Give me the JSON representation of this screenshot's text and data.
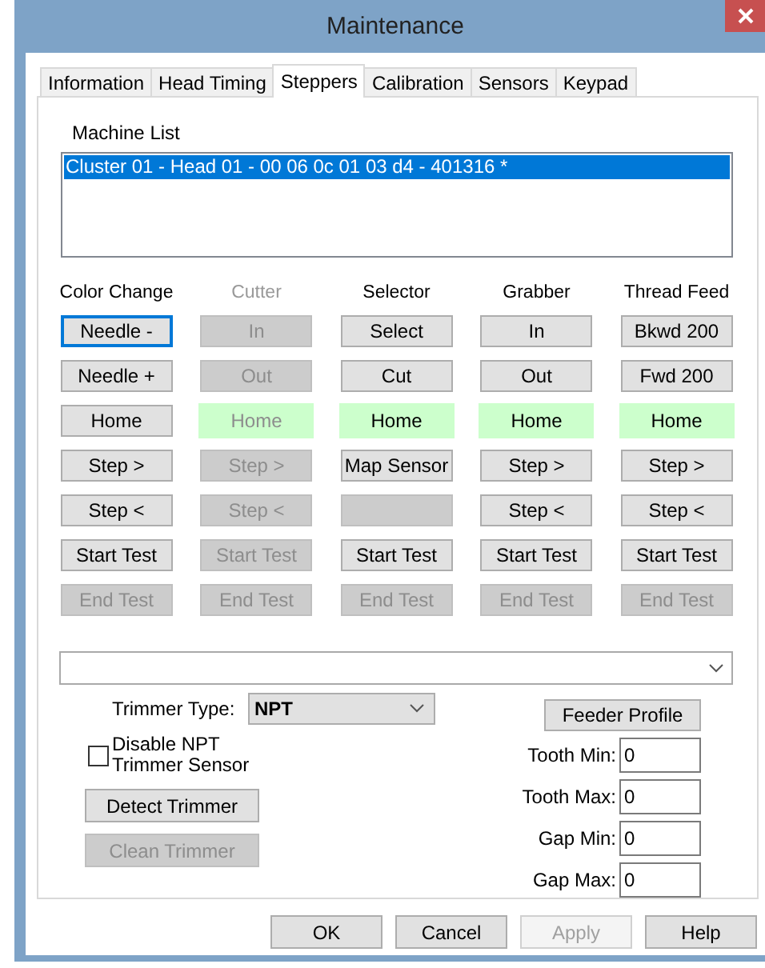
{
  "window": {
    "title": "Maintenance"
  },
  "tabs": [
    {
      "label": "Information",
      "selected": false
    },
    {
      "label": "Head Timing",
      "selected": false
    },
    {
      "label": "Steppers",
      "selected": true
    },
    {
      "label": "Calibration",
      "selected": false
    },
    {
      "label": "Sensors",
      "selected": false
    },
    {
      "label": "Keypad",
      "selected": false
    }
  ],
  "machine_list": {
    "label": "Machine List",
    "items": [
      {
        "text": "Cluster 01 - Head 01 - 00 06 0c 01 03 d4 - 401316 *",
        "selected": true
      }
    ]
  },
  "steppers": [
    {
      "title": "Color Change",
      "disabled": false,
      "buttons": [
        {
          "label": "Needle -",
          "disabled": false,
          "highlighted": false,
          "focused": true
        },
        {
          "label": "Needle +",
          "disabled": false,
          "highlighted": false,
          "focused": false
        },
        {
          "label": "Home",
          "disabled": false,
          "highlighted": false,
          "focused": false
        },
        {
          "label": "Step >",
          "disabled": false,
          "highlighted": false,
          "focused": false
        },
        {
          "label": "Step <",
          "disabled": false,
          "highlighted": false,
          "focused": false
        },
        {
          "label": "Start Test",
          "disabled": false,
          "highlighted": false,
          "focused": false
        },
        {
          "label": "End Test",
          "disabled": true,
          "highlighted": false,
          "focused": false
        }
      ]
    },
    {
      "title": "Cutter",
      "disabled": true,
      "buttons": [
        {
          "label": "In",
          "disabled": true,
          "highlighted": false,
          "focused": false
        },
        {
          "label": "Out",
          "disabled": true,
          "highlighted": false,
          "focused": false
        },
        {
          "label": "Home",
          "disabled": true,
          "highlighted": true,
          "focused": false
        },
        {
          "label": "Step >",
          "disabled": true,
          "highlighted": false,
          "focused": false
        },
        {
          "label": "Step <",
          "disabled": true,
          "highlighted": false,
          "focused": false
        },
        {
          "label": "Start Test",
          "disabled": true,
          "highlighted": false,
          "focused": false
        },
        {
          "label": "End Test",
          "disabled": true,
          "highlighted": false,
          "focused": false
        }
      ]
    },
    {
      "title": "Selector",
      "disabled": false,
      "buttons": [
        {
          "label": "Select",
          "disabled": false,
          "highlighted": false,
          "focused": false
        },
        {
          "label": "Cut",
          "disabled": false,
          "highlighted": false,
          "focused": false
        },
        {
          "label": "Home",
          "disabled": false,
          "highlighted": true,
          "focused": false
        },
        {
          "label": "Map Sensor",
          "disabled": false,
          "highlighted": false,
          "focused": false
        },
        {
          "disabled": true,
          "highlighted": false,
          "focused": false
        },
        {
          "label": "Start Test",
          "disabled": false,
          "highlighted": false,
          "focused": false
        },
        {
          "label": "End Test",
          "disabled": true,
          "highlighted": false,
          "focused": false
        }
      ]
    },
    {
      "title": "Grabber",
      "disabled": false,
      "buttons": [
        {
          "label": "In",
          "disabled": false,
          "highlighted": false,
          "focused": false
        },
        {
          "label": "Out",
          "disabled": false,
          "highlighted": false,
          "focused": false
        },
        {
          "label": "Home",
          "disabled": false,
          "highlighted": true,
          "focused": false
        },
        {
          "label": "Step >",
          "disabled": false,
          "highlighted": false,
          "focused": false
        },
        {
          "label": "Step <",
          "disabled": false,
          "highlighted": false,
          "focused": false
        },
        {
          "label": "Start Test",
          "disabled": false,
          "highlighted": false,
          "focused": false
        },
        {
          "label": "End Test",
          "disabled": true,
          "highlighted": false,
          "focused": false
        }
      ]
    },
    {
      "title": "Thread Feed",
      "disabled": false,
      "buttons": [
        {
          "label": "Bkwd 200",
          "disabled": false,
          "highlighted": false,
          "focused": false
        },
        {
          "label": "Fwd 200",
          "disabled": false,
          "highlighted": false,
          "focused": false
        },
        {
          "label": "Home",
          "disabled": false,
          "highlighted": true,
          "focused": false
        },
        {
          "label": "Step >",
          "disabled": false,
          "highlighted": false,
          "focused": false
        },
        {
          "label": "Step <",
          "disabled": false,
          "highlighted": false,
          "focused": false
        },
        {
          "label": "Start Test",
          "disabled": false,
          "highlighted": false,
          "focused": false
        },
        {
          "label": "End Test",
          "disabled": true,
          "highlighted": false,
          "focused": false
        }
      ]
    }
  ],
  "trimmer": {
    "type_label": "Trimmer Type:",
    "type_value": "NPT",
    "disable_sensor": {
      "label": "Disable NPT Trimmer Sensor",
      "checked": false
    },
    "buttons": [
      {
        "label": "Detect Trimmer",
        "disabled": false
      },
      {
        "label": "Clean Trimmer",
        "disabled": true
      }
    ]
  },
  "feeder": {
    "button": "Feeder Profile",
    "fields": [
      {
        "label": "Tooth Min:",
        "value": "0"
      },
      {
        "label": "Tooth Max:",
        "value": "0"
      },
      {
        "label": "Gap Min:",
        "value": "0"
      },
      {
        "label": "Gap Max:",
        "value": "0"
      }
    ]
  },
  "dialog_buttons": [
    {
      "label": "OK",
      "disabled": false
    },
    {
      "label": "Cancel",
      "disabled": false
    },
    {
      "label": "Apply",
      "disabled": true
    },
    {
      "label": "Help",
      "disabled": false
    }
  ]
}
